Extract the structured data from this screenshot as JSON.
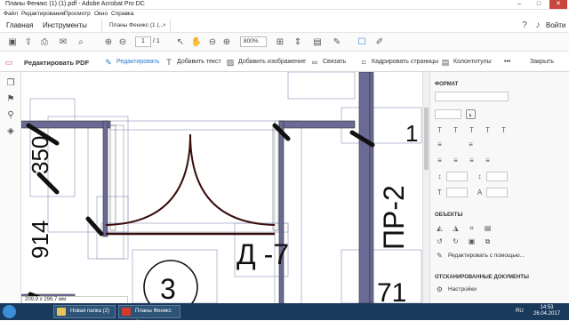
{
  "window": {
    "title": "Планы Феникс (1) (1).pdf - Adobe Acrobat Pro DC",
    "min": "–",
    "max": "□",
    "close": "✕"
  },
  "menu": [
    "Файл",
    "Редактирование",
    "Просмотр",
    "Окно",
    "Справка"
  ],
  "nav": {
    "home": "Главная",
    "tools": "Инструменты",
    "signin": "Войти"
  },
  "doc_tab": {
    "label": "Планы Феникс (1 (...",
    "close": "×"
  },
  "toolbar": {
    "page_current": "1",
    "page_total": "/ 1",
    "zoom": "800%"
  },
  "editbar": {
    "title": "Редактировать PDF",
    "edit": "Редактировать",
    "add_text": "Добавить текст",
    "add_image": "Добавить изображение",
    "link": "Связать",
    "crop": "Кадрировать страницы",
    "headers": "Колонтитулы",
    "more": "•••",
    "close": "Закрыть"
  },
  "drawing": {
    "label_350": "350",
    "label_914": "914",
    "label_pr2": "ПР-2",
    "label_d7": "Д -7",
    "label_3": "3",
    "label_71": "71",
    "label_1": "1"
  },
  "panel": {
    "format": "ФОРМАТ",
    "objects": "ОБЪЕКТЫ",
    "edit_with": "Редактировать с помощью...",
    "scanned": "ОТСКАНИРОВАННЫЕ ДОКУМЕНТЫ",
    "settings": "Настройки"
  },
  "status": {
    "size": "209,9 x 296,7 мм"
  },
  "taskbar": {
    "folder": "Новая папка (2)",
    "acrobat": "Планы Феникс (1...",
    "lang": "RU",
    "time": "14:53",
    "date": "26.04.2017"
  }
}
